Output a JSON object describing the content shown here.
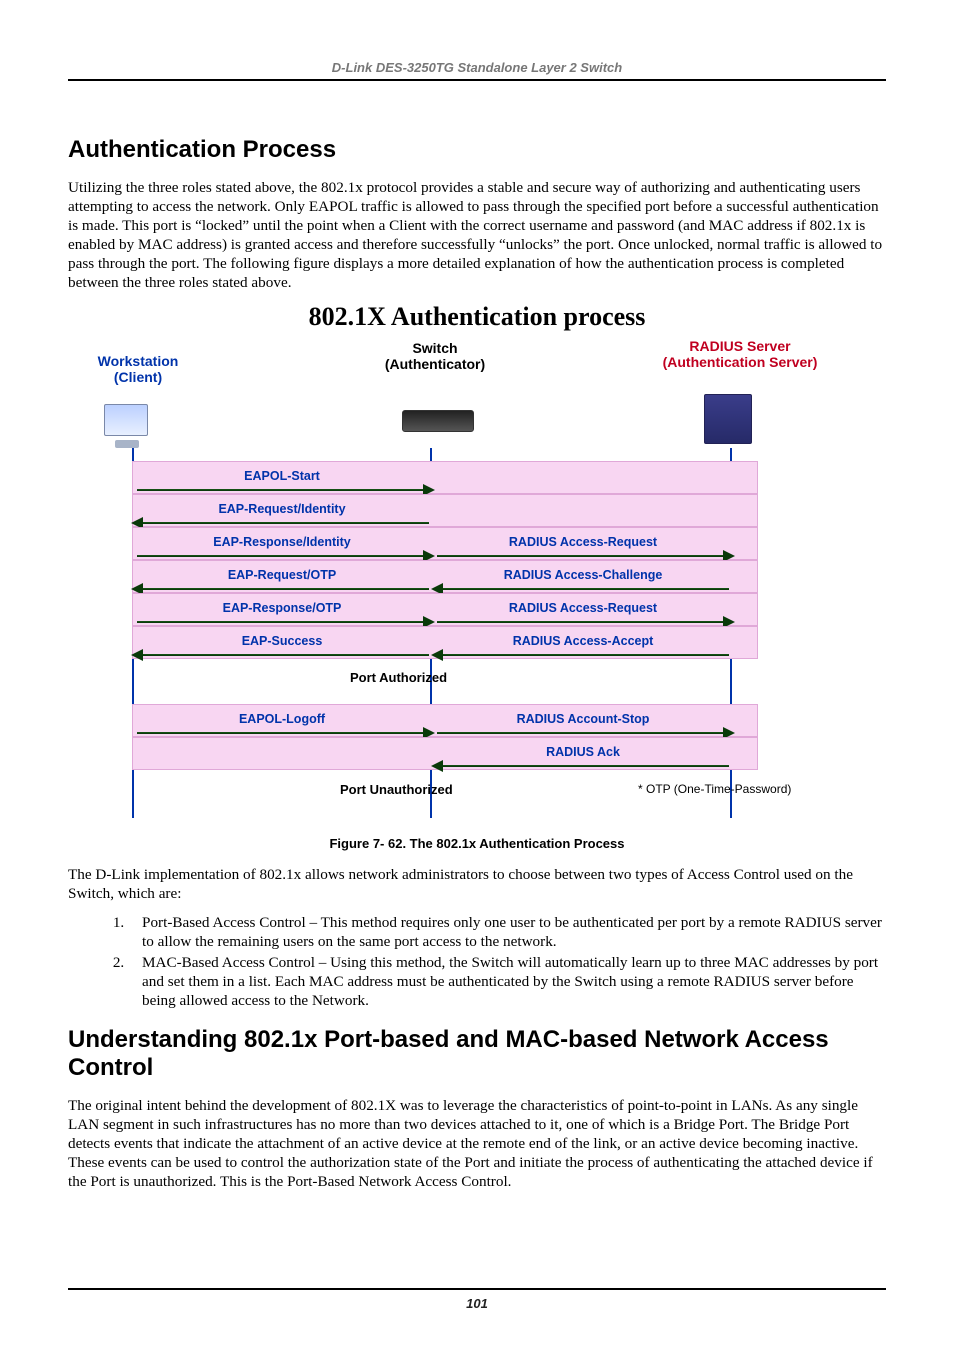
{
  "header": {
    "running_head": "D-Link DES-3250TG Standalone Layer 2 Switch"
  },
  "section1": {
    "title": "Authentication Process",
    "para": "Utilizing the three roles stated above, the 802.1x protocol provides a stable and secure way of authorizing and authenticating users attempting to access the network. Only EAPOL traffic is allowed to pass through the specified port before a successful authentication is made. This port is “locked” until the point when a Client with the correct username and password (and MAC address if 802.1x is enabled by MAC address) is granted access and therefore successfully “unlocks” the port. Once unlocked, normal traffic is allowed to pass through the port. The following figure displays a more detailed explanation of how the authentication process is completed between the three roles stated above."
  },
  "figure": {
    "title": "802.1X Authentication process",
    "roles": {
      "client": "Workstation\n(Client)",
      "switch": "Switch\n(Authenticator)",
      "radius": "RADIUS Server\n(Authentication Server)"
    },
    "rows": [
      {
        "left": "EAPOL-Start",
        "right": "",
        "ldir": "r",
        "rdir": ""
      },
      {
        "left": "EAP-Request/Identity",
        "right": "",
        "ldir": "l",
        "rdir": ""
      },
      {
        "left": "EAP-Response/Identity",
        "right": "RADIUS Access-Request",
        "ldir": "r",
        "rdir": "r"
      },
      {
        "left": "EAP-Request/OTP",
        "right": "RADIUS Access-Challenge",
        "ldir": "l",
        "rdir": "l"
      },
      {
        "left": "EAP-Response/OTP",
        "right": "RADIUS Access-Request",
        "ldir": "r",
        "rdir": "r"
      },
      {
        "left": "EAP-Success",
        "right": "RADIUS Access-Accept",
        "ldir": "l",
        "rdir": "l"
      }
    ],
    "state_authorized": "Port Authorized",
    "rows2": [
      {
        "left": "EAPOL-Logoff",
        "right": "RADIUS Account-Stop",
        "ldir": "r",
        "rdir": "r"
      },
      {
        "left": "",
        "right": "RADIUS Ack",
        "ldir": "",
        "rdir": "l"
      }
    ],
    "state_unauthorized": "Port Unauthorized",
    "footnote": "* OTP (One-Time-Password)",
    "caption": "Figure 7- 62. The 802.1x Authentication Process"
  },
  "post_figure": {
    "para": "The D-Link implementation of 802.1x allows network administrators to choose between two types of Access Control used on the Switch, which are:",
    "item1": "Port-Based Access Control – This method requires only one user to be authenticated per port by a remote RADIUS server to allow the remaining users on the same port access to the network.",
    "item2": "MAC-Based Access Control – Using this method, the Switch will automatically learn up to three MAC addresses by port and set them in a list. Each MAC address must be authenticated by the Switch using a remote RADIUS server before being allowed access to the Network."
  },
  "section2": {
    "title": "Understanding 802.1x Port-based and MAC-based Network Access Control",
    "para": "The original intent behind the development of 802.1X was to leverage the characteristics of point-to-point in LANs. As any single LAN segment in such infrastructures has no more than two devices attached to it, one of which is a Bridge Port.   The Bridge Port detects events that indicate the attachment of an active device at the remote end of the link, or an active device becoming inactive. These events can be used to control the authorization state of the Port and initiate the process of authenticating the attached device if the Port is unauthorized. This is the Port-Based Network Access Control."
  },
  "footer": {
    "page_number": "101"
  }
}
